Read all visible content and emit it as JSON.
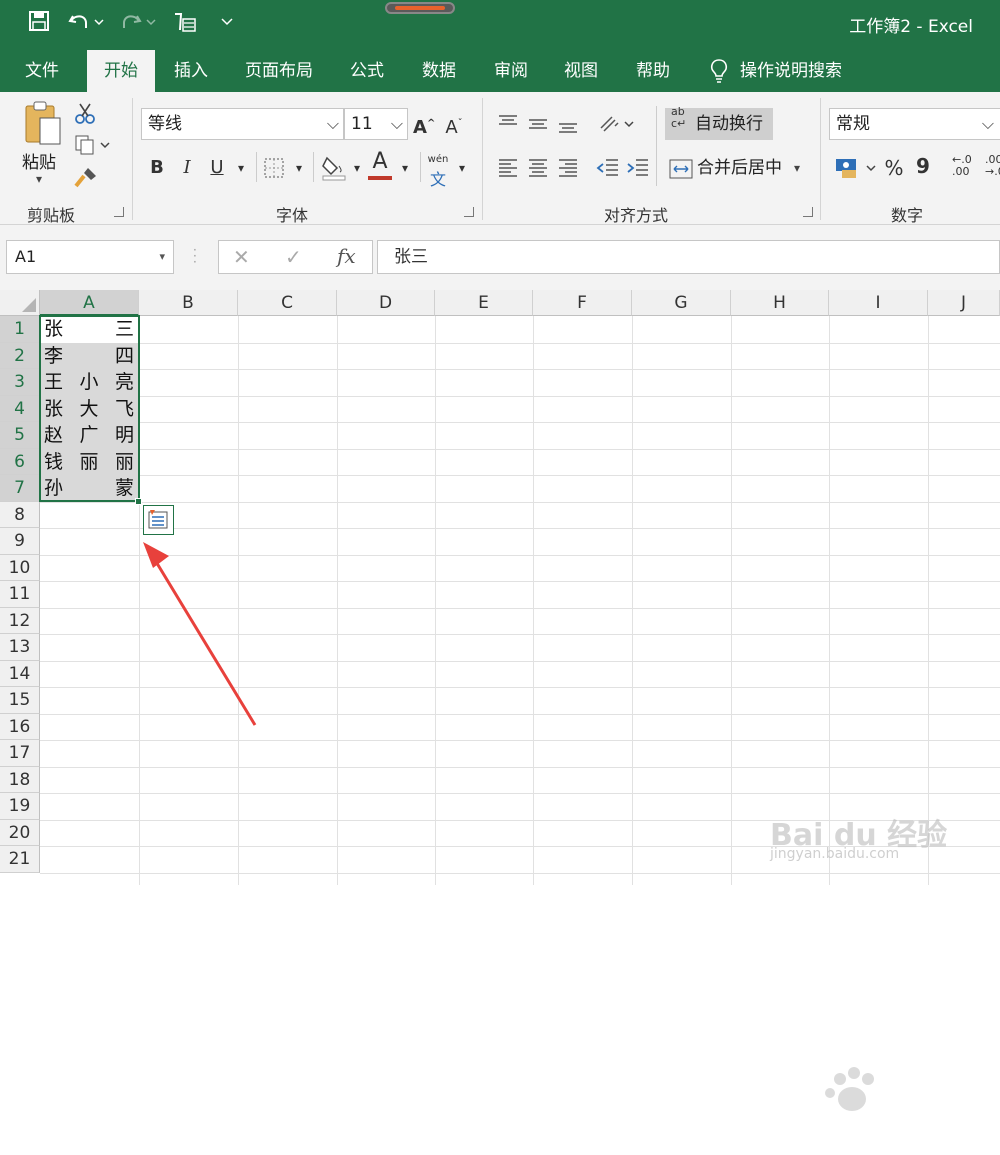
{
  "title_bar": {
    "document_title": "工作簿2  -  Excel"
  },
  "tabs": [
    "文件",
    "开始",
    "插入",
    "页面布局",
    "公式",
    "数据",
    "审阅",
    "视图",
    "帮助"
  ],
  "tell_me": "操作说明搜索",
  "ribbon": {
    "clipboard": {
      "paste_label": "粘贴",
      "group_label": "剪贴板"
    },
    "font": {
      "font_name": "等线",
      "font_size": "11",
      "group_label": "字体",
      "bold": "B",
      "italic": "I",
      "underline": "U",
      "grow": "A",
      "shrink": "A",
      "font_color": "A",
      "phonetic_top": "wén",
      "phonetic_bottom": "文"
    },
    "alignment": {
      "wrap_text": "自动换行",
      "merge_center": "合并后居中",
      "group_label": "对齐方式"
    },
    "number": {
      "format": "常规",
      "group_label": "数字",
      "percent": "%",
      "comma": "9",
      "inc_decimal_top": "←.0",
      "inc_decimal_bottom": ".00",
      "dec_decimal_top": ".00",
      "dec_decimal_bottom": "→.0"
    }
  },
  "formula_bar": {
    "name_box": "A1",
    "cancel": "✕",
    "enter": "✓",
    "fx": "fx",
    "formula": "张三"
  },
  "columns": [
    "A",
    "B",
    "C",
    "D",
    "E",
    "F",
    "G",
    "H",
    "I",
    "J"
  ],
  "rows": [
    "1",
    "2",
    "3",
    "4",
    "5",
    "6",
    "7",
    "8",
    "9",
    "10",
    "11",
    "12",
    "13",
    "14",
    "15",
    "16",
    "17",
    "18",
    "19",
    "20",
    "21"
  ],
  "cells": [
    [
      "张",
      "",
      "三"
    ],
    [
      "李",
      "",
      "四"
    ],
    [
      "王",
      "小",
      "亮"
    ],
    [
      "张",
      "大",
      "飞"
    ],
    [
      "赵",
      "广",
      "明"
    ],
    [
      "钱",
      "丽",
      "丽"
    ],
    [
      "孙",
      "",
      "蒙"
    ]
  ],
  "watermark": {
    "brand": "Bai du 经验",
    "url": "jingyan.baidu.com"
  },
  "colors": {
    "accent": "#217346",
    "arrow": "#e8413c"
  }
}
